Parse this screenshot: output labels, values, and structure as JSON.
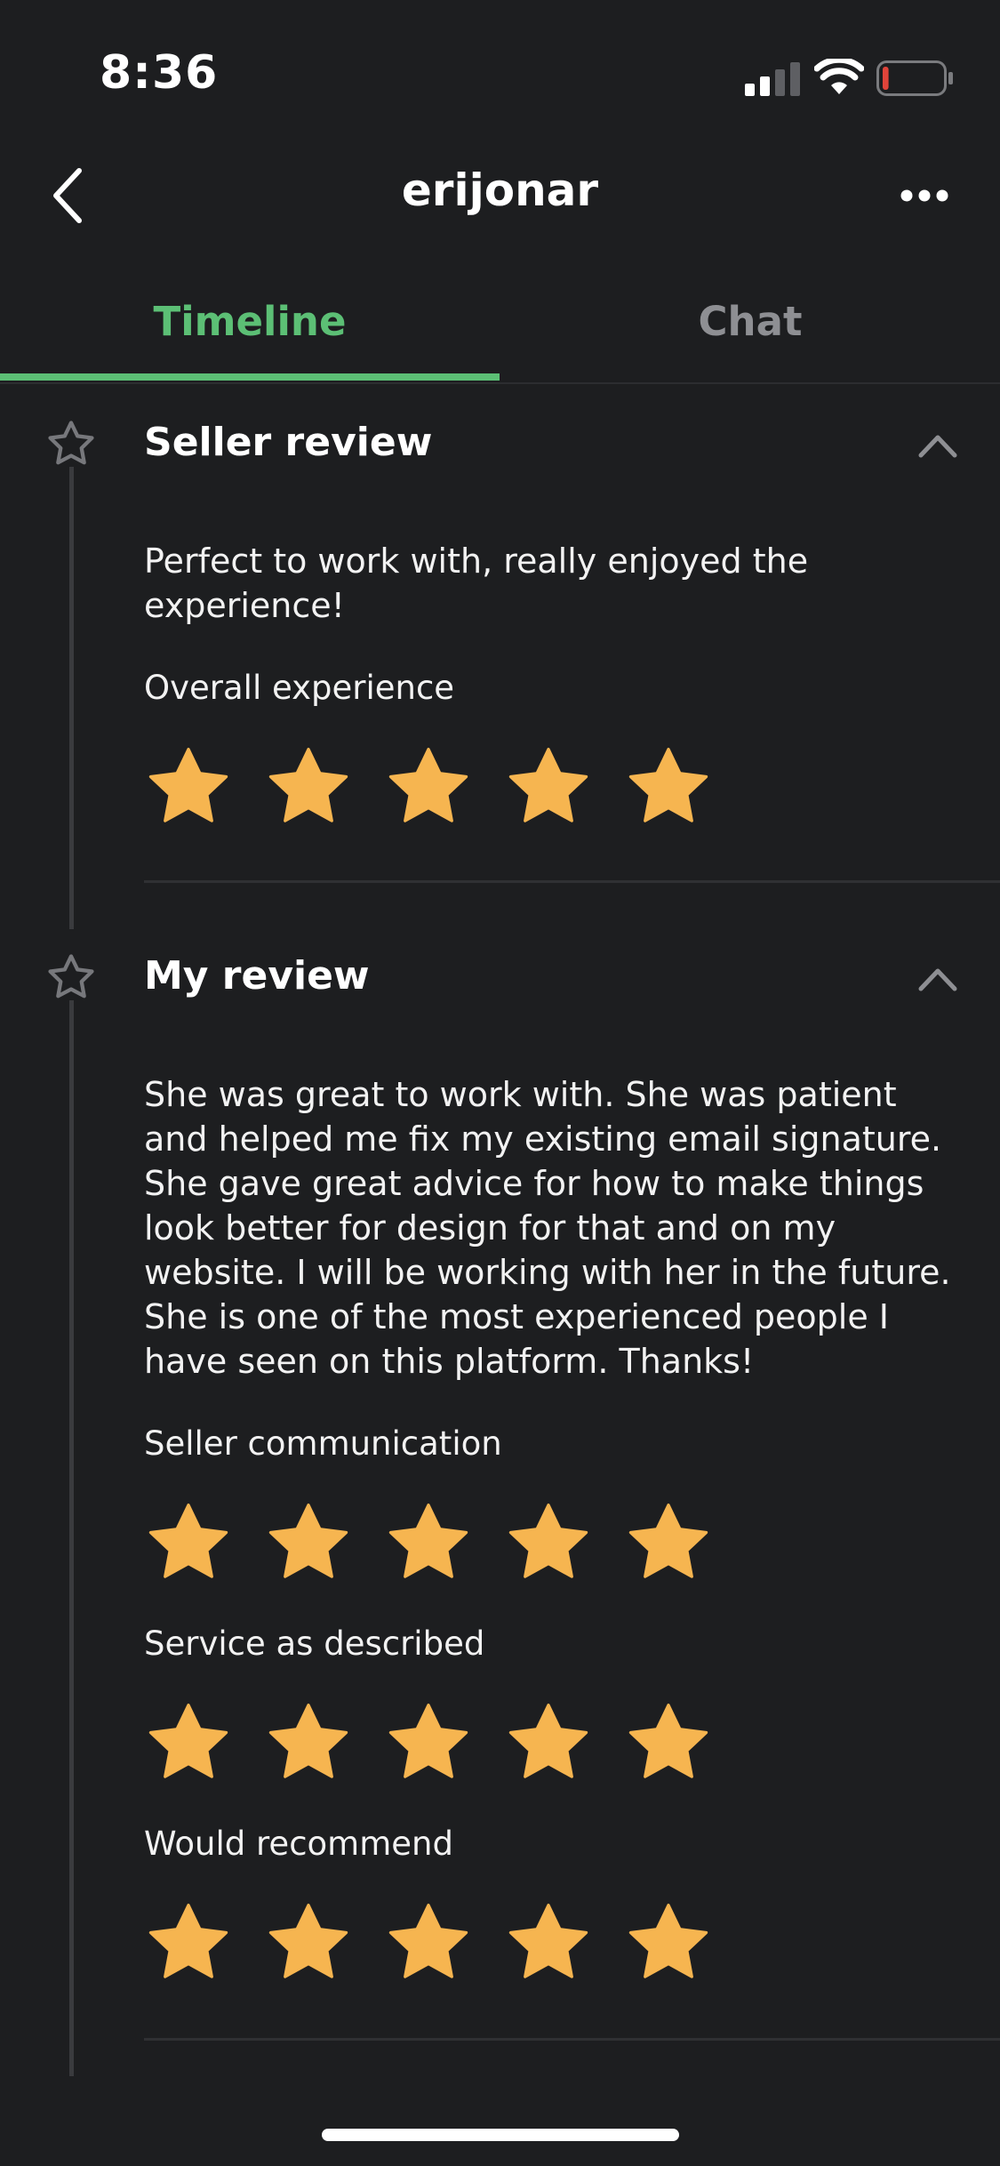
{
  "status_bar": {
    "time": "8:36",
    "icons": [
      "cellular-signal-icon",
      "wifi-icon",
      "battery-low-icon"
    ],
    "battery_level": 0.1
  },
  "nav": {
    "title": "erijonar",
    "back_icon": "chevron-left-icon",
    "more_icon": "more-horizontal-icon"
  },
  "tabs": [
    {
      "label": "Timeline",
      "active": true
    },
    {
      "label": "Chat",
      "active": false
    }
  ],
  "colors": {
    "background": "#1d1e20",
    "accent_green": "#5cbf75",
    "star_gold": "#f6b550",
    "muted_text": "#8e8f93"
  },
  "seller_review": {
    "title": "Seller review",
    "text": "Perfect to work with, really enjoyed the experience!",
    "ratings": [
      {
        "label": "Overall experience",
        "stars": 5,
        "max": 5
      }
    ]
  },
  "my_review": {
    "title": "My review",
    "text": "She was great to work with. She was patient and helped me fix my existing email signature. She gave great advice for how to make things look better for design for that and on my website. I will be working with her in the future. She is one of the most experienced people I have seen on this platform.  Thanks!",
    "ratings": [
      {
        "label": "Seller communication",
        "stars": 5,
        "max": 5
      },
      {
        "label": "Service as described",
        "stars": 5,
        "max": 5
      },
      {
        "label": "Would recommend",
        "stars": 5,
        "max": 5
      }
    ]
  }
}
